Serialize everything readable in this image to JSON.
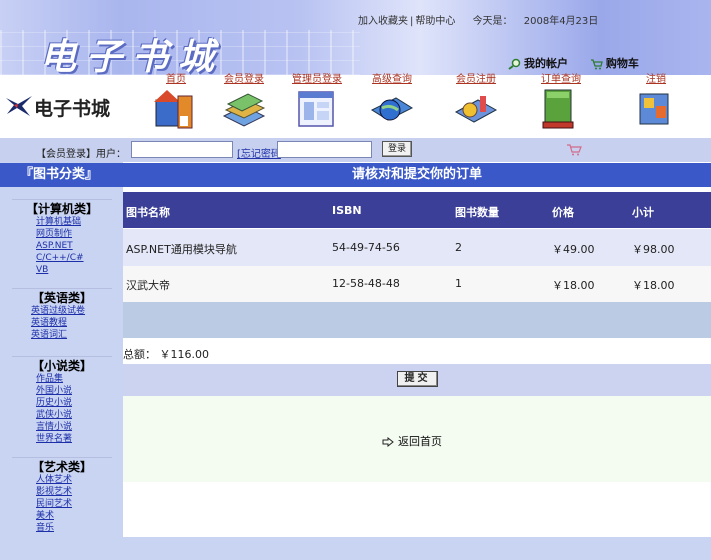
{
  "header": {
    "top_links": [
      "加入收藏夹",
      "帮助中心"
    ],
    "today_label": "今天是：",
    "date": "2008年4月23日",
    "site_title": "电子书城",
    "my_account": "我的帐户",
    "cart": "购物车",
    "logo_text": "电子书城"
  },
  "nav": [
    {
      "label": "首页",
      "icon": "house-book-icon"
    },
    {
      "label": "会员登录",
      "icon": "book-stack-icon"
    },
    {
      "label": "管理员登录",
      "icon": "window-icon"
    },
    {
      "label": "高级查询",
      "icon": "globe-search-icon"
    },
    {
      "label": "会员注册",
      "icon": "register-icon"
    },
    {
      "label": "订单查询",
      "icon": "books-icon"
    },
    {
      "label": "注销",
      "icon": "logout-icon"
    }
  ],
  "login": {
    "label": "【会员登录】用户：",
    "password_link": "忘记密码",
    "button": "登录"
  },
  "sidebar": {
    "title": "『图书分类』",
    "categories": [
      {
        "name": "【计算机类】",
        "items": [
          "计算机基础",
          "网页制作",
          "ASP.NET",
          "C/C++/C#",
          "VB"
        ]
      },
      {
        "name": "【英语类】",
        "items": [
          "英语过级试卷",
          "英语教程",
          "英语词汇"
        ]
      },
      {
        "name": "【小说类】",
        "items": [
          "作品集",
          "外国小说",
          "历史小说",
          "武侠小说",
          "言情小说",
          "世界名著"
        ]
      },
      {
        "name": "【艺术类】",
        "items": [
          "人体艺术",
          "影视艺术",
          "民间艺术",
          "美术",
          "音乐"
        ]
      }
    ]
  },
  "order": {
    "title": "请核对和提交你的订单",
    "headers": [
      "图书名称",
      "ISBN",
      "图书数量",
      "价格",
      "小计"
    ],
    "rows": [
      [
        "ASP.NET通用模块导航",
        "54-49-74-56",
        "2",
        "￥49.00",
        "￥98.00"
      ],
      [
        "汉武大帝",
        "12-58-48-48",
        "1",
        "￥18.00",
        "￥18.00"
      ]
    ],
    "total_label": "总额：",
    "total_value": "￥116.00",
    "submit": "提交",
    "back": "返回首页"
  },
  "colors": {
    "header_blue": "#3a58c7",
    "table_head": "#3b3f97",
    "sidebar_bg": "#c9d4f2"
  }
}
